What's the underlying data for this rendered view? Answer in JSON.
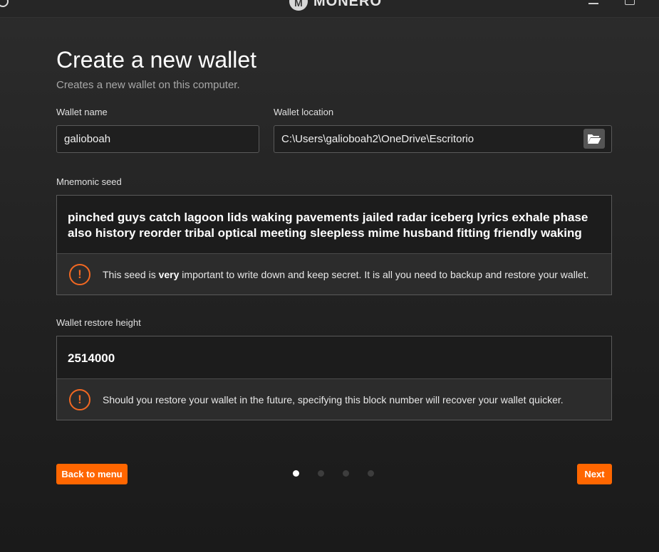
{
  "titlebar": {
    "brand_logo_letter": "M",
    "brand_name": "MONERO"
  },
  "page": {
    "title": "Create a new wallet",
    "subtitle": "Creates a new wallet on this computer."
  },
  "wallet_name": {
    "label": "Wallet name",
    "value": "galioboah"
  },
  "wallet_location": {
    "label": "Wallet location",
    "value": "C:\\Users\\galioboah2\\OneDrive\\Escritorio",
    "browse_icon": "folder-open-icon"
  },
  "mnemonic": {
    "label": "Mnemonic seed",
    "seed": "pinched guys catch lagoon lids waking pavements jailed radar iceberg lyrics exhale phase also history reorder tribal optical meeting sleepless mime husband fitting friendly waking",
    "warning_prefix": "This seed is ",
    "warning_emphasis": "very",
    "warning_suffix": " important to write down and keep secret. It is all you need to backup and restore your wallet.",
    "warning_icon": "!"
  },
  "restore_height": {
    "label": "Wallet restore height",
    "value": "2514000",
    "warning": "Should you restore your wallet in the future, specifying this block number will recover your wallet quicker.",
    "warning_icon": "!"
  },
  "navigation": {
    "back_label": "Back to menu",
    "next_label": "Next",
    "steps_total": 4,
    "current_step": 1
  },
  "colors": {
    "accent": "#ff6600",
    "warning": "#f26822",
    "background": "#232323"
  }
}
